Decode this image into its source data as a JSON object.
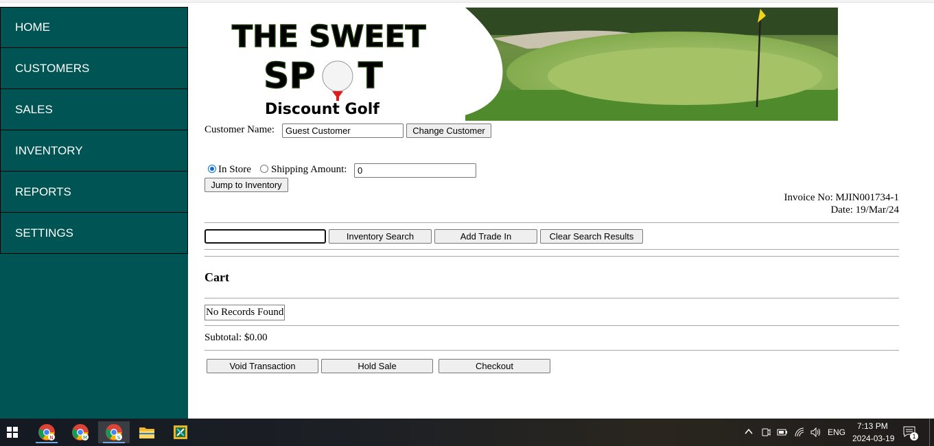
{
  "nav": {
    "items": [
      {
        "label": "HOME"
      },
      {
        "label": "CUSTOMERS"
      },
      {
        "label": "SALES"
      },
      {
        "label": "INVENTORY"
      },
      {
        "label": "REPORTS"
      },
      {
        "label": "SETTINGS"
      }
    ]
  },
  "banner": {
    "line1": "THE SWEET",
    "line2a": "SP",
    "line2b": "T",
    "line3": "Discount Golf"
  },
  "customer": {
    "label": "Customer Name:",
    "value": "Guest Customer",
    "change_button": "Change Customer"
  },
  "delivery": {
    "in_store_label": "In Store",
    "shipping_label": "Shipping Amount:",
    "shipping_value": "0",
    "selected": "in_store"
  },
  "jump_button": "Jump to Inventory",
  "invoice": {
    "number_text": "Invoice No: MJIN001734-1",
    "date_text": "Date: 19/Mar/24"
  },
  "search": {
    "value": "",
    "inventory_search_button": "Inventory Search",
    "add_trade_in_button": "Add Trade In",
    "clear_results_button": "Clear Search Results"
  },
  "cart": {
    "heading": "Cart",
    "empty_text": "No Records Found",
    "subtotal_text": "Subtotal: $0.00"
  },
  "actions": {
    "void": "Void Transaction",
    "hold": "Hold Sale",
    "checkout": "Checkout"
  },
  "taskbar": {
    "language": "ENG",
    "time": "7:13 PM",
    "date": "2024-03-19",
    "notification_count": "1",
    "chrome_badges": [
      "N",
      "M",
      "S"
    ]
  },
  "colors": {
    "sidebar": "#005454",
    "accent": "#0a6cd8"
  }
}
